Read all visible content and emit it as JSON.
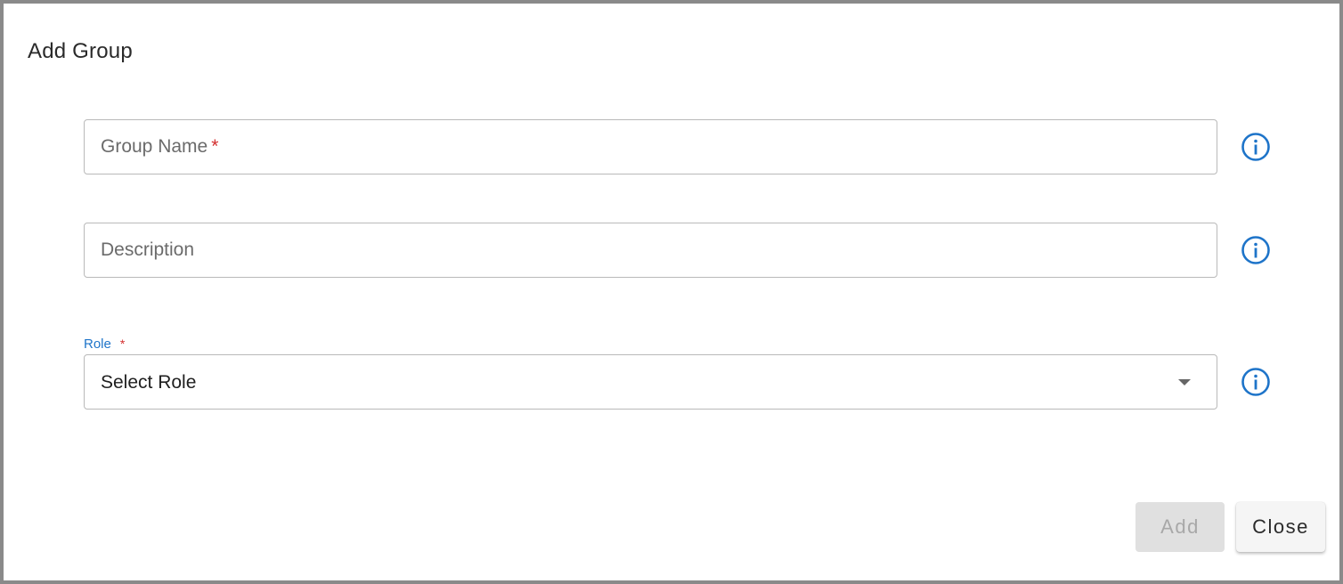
{
  "dialog": {
    "title": "Add Group"
  },
  "form": {
    "group_name": {
      "placeholder": "Group Name",
      "required_mark": "*",
      "value": ""
    },
    "description": {
      "placeholder": "Description",
      "value": ""
    },
    "role": {
      "label": "Role",
      "required_mark": "*",
      "selected": "Select Role"
    }
  },
  "icons": {
    "info": "info-circle-icon",
    "dropdown": "caret-down-icon"
  },
  "buttons": {
    "add_label": "Add",
    "close_label": "Close"
  },
  "colors": {
    "accent": "#1e74c9",
    "required": "#d32f2f",
    "disabled_bg": "#e0e0e0",
    "disabled_text": "#a8a8a8"
  }
}
